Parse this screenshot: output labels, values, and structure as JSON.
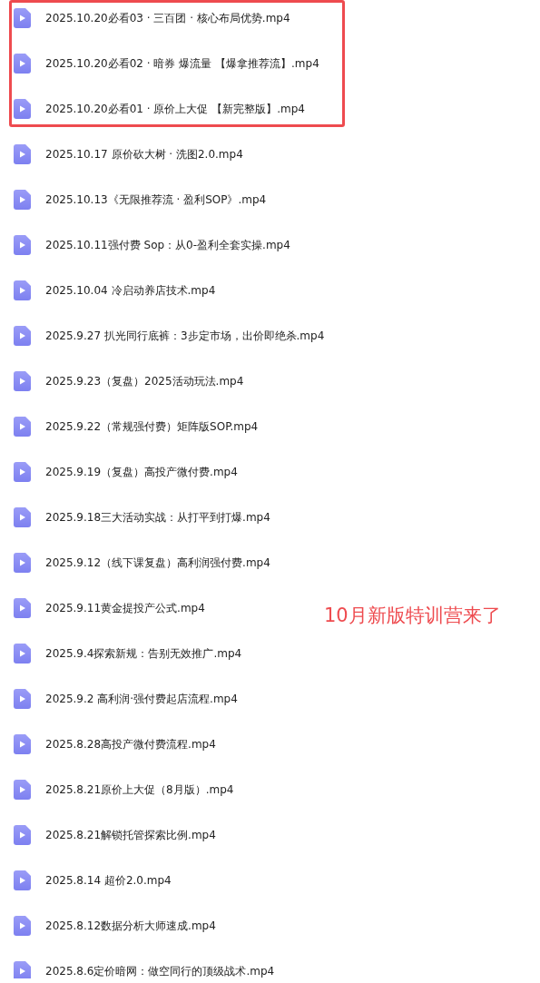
{
  "files": [
    {
      "name": "2025.10.20必看03 · 三百团 · 核心布局优势.mp4",
      "highlighted": true
    },
    {
      "name": "2025.10.20必看02 · 暗券 爆流量 【爆拿推荐流】.mp4",
      "highlighted": true
    },
    {
      "name": "2025.10.20必看01 · 原价上大促 【新完整版】.mp4",
      "highlighted": true
    },
    {
      "name": "2025.10.17 原价砍大树 · 洗图2.0.mp4",
      "highlighted": false
    },
    {
      "name": "2025.10.13《无限推荐流 · 盈利SOP》.mp4",
      "highlighted": false
    },
    {
      "name": "2025.10.11强付费 Sop：从0-盈利全套实操.mp4",
      "highlighted": false
    },
    {
      "name": "2025.10.04 冷启动养店技术.mp4",
      "highlighted": false
    },
    {
      "name": "2025.9.27 扒光同行底裤：3步定市场，出价即绝杀.mp4",
      "highlighted": false
    },
    {
      "name": "2025.9.23（复盘）2025活动玩法.mp4",
      "highlighted": false
    },
    {
      "name": "2025.9.22（常规强付费）矩阵版SOP.mp4",
      "highlighted": false
    },
    {
      "name": "2025.9.19（复盘）高投产微付费.mp4",
      "highlighted": false
    },
    {
      "name": "2025.9.18三大活动实战：从打平到打爆.mp4",
      "highlighted": false
    },
    {
      "name": "2025.9.12（线下课复盘）高利润强付费.mp4",
      "highlighted": false
    },
    {
      "name": "2025.9.11黄金提投产公式.mp4",
      "highlighted": false
    },
    {
      "name": "2025.9.4探索新规：告别无效推广.mp4",
      "highlighted": false
    },
    {
      "name": "2025.9.2 高利润·强付费起店流程.mp4",
      "highlighted": false
    },
    {
      "name": "2025.8.28高投产微付费流程.mp4",
      "highlighted": false
    },
    {
      "name": "2025.8.21原价上大促（8月版）.mp4",
      "highlighted": false
    },
    {
      "name": "2025.8.21解锁托管探索比例.mp4",
      "highlighted": false
    },
    {
      "name": "2025.8.14 超价2.0.mp4",
      "highlighted": false
    },
    {
      "name": "2025.8.12数据分析大师速成.mp4",
      "highlighted": false
    },
    {
      "name": "2025.8.6定价暗网：做空同行的顶级战术.mp4",
      "highlighted": false
    }
  ],
  "annotation": {
    "text": "10月新版特训营来了"
  }
}
